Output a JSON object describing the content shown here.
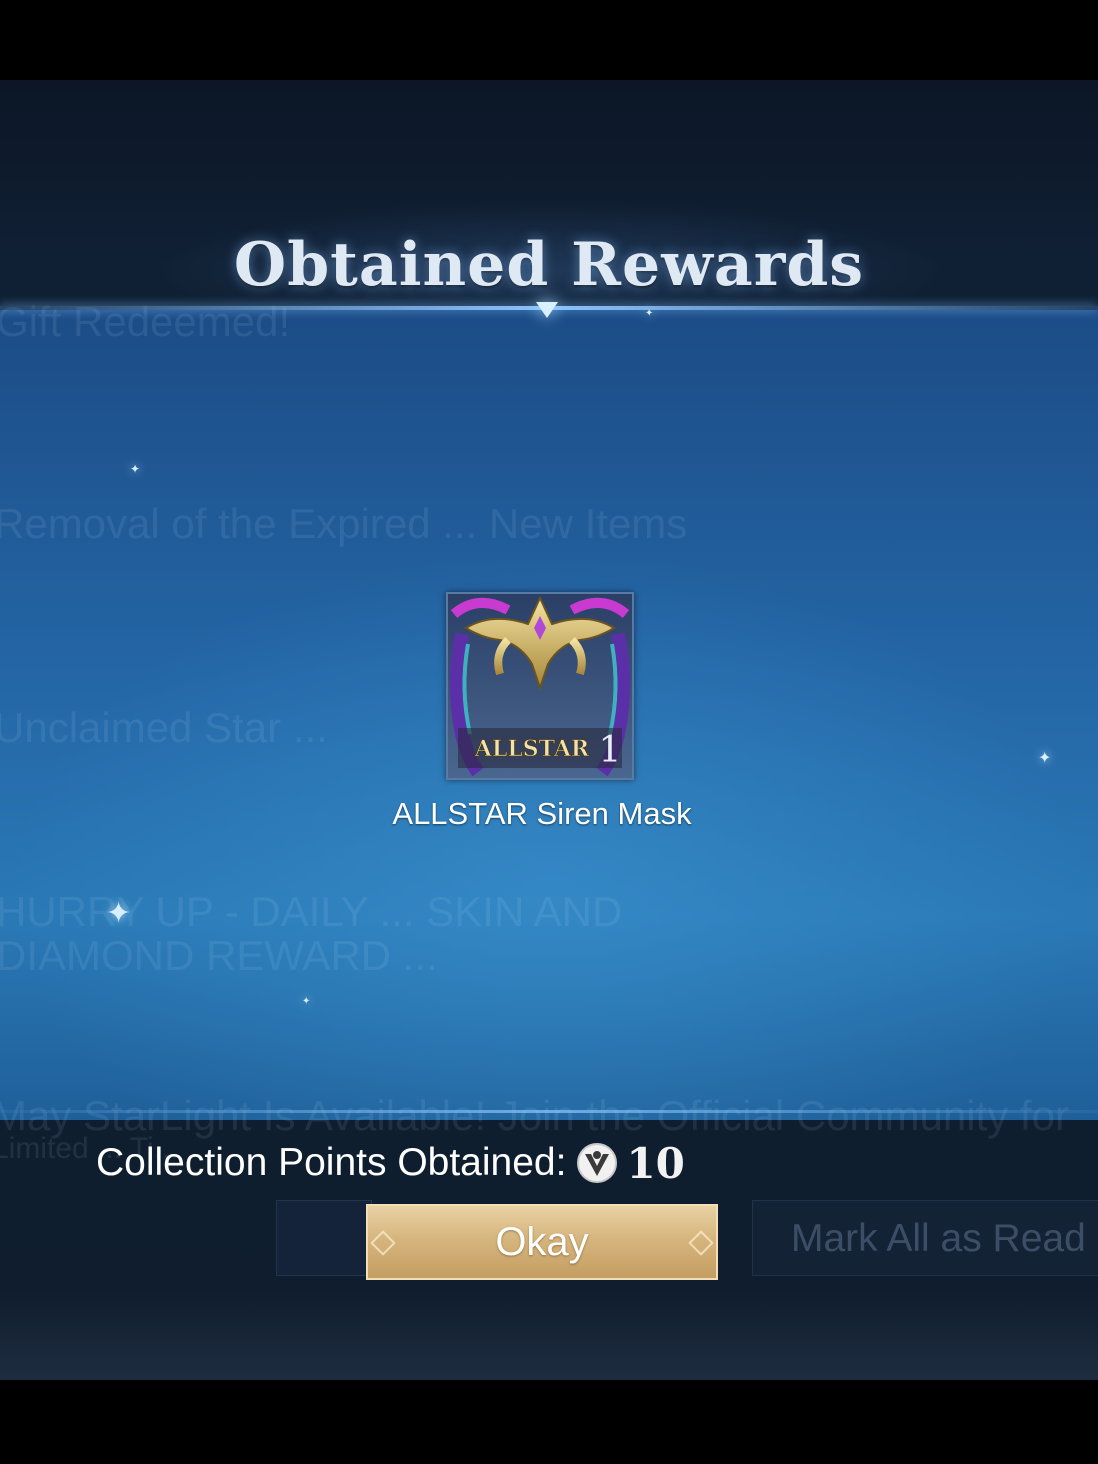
{
  "dialog": {
    "title": "Obtained Rewards"
  },
  "background_mail_list": [
    "Gift Redeemed!",
    "Removal of the Expired ... New Items",
    "Unclaimed Star ...",
    "HURRY UP - DAILY ... SKIN AND",
    "DIAMOND REWARD ...",
    "May StarLight Is Available! Join the Official Community for",
    "Limited ... Ti..."
  ],
  "reward": {
    "name": "ALLSTAR Siren Mask",
    "badge_text": "ALLSTAR",
    "badge_number": "1",
    "icon": "siren-mask-avatar-border-icon"
  },
  "collection": {
    "label": "Collection Points Obtained:",
    "icon": "collection-point-coin-icon",
    "value": "10"
  },
  "buttons": {
    "okay": "Okay",
    "mark_all_read": "Mark All as Read"
  },
  "colors": {
    "title": "#dfe9f3",
    "panel": "#2466a6",
    "okay_button": "#d6b67e",
    "accent_line": "#8cc4ff"
  }
}
